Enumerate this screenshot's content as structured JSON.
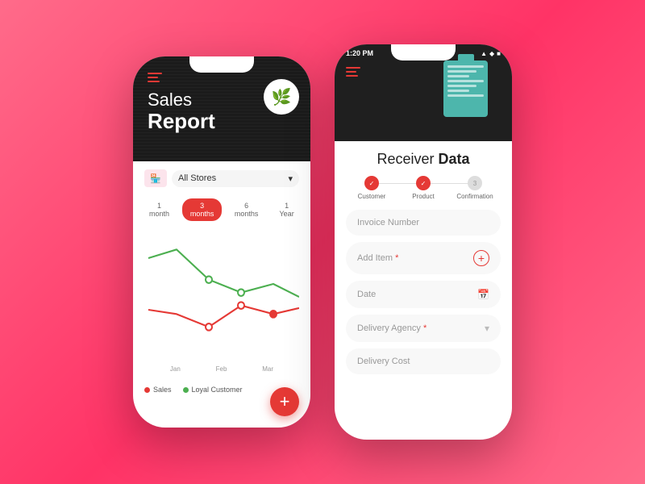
{
  "left_phone": {
    "header": {
      "title": "Sales",
      "title_bold": "Report",
      "store_label": "All Stores"
    },
    "periods": [
      {
        "label": "1 month",
        "active": false
      },
      {
        "label": "3 months",
        "active": true
      },
      {
        "label": "6 months",
        "active": false
      },
      {
        "label": "1 Year",
        "active": false
      }
    ],
    "x_labels": [
      "Jan",
      "Feb",
      "Mar"
    ],
    "legend": [
      {
        "label": "Sales",
        "color": "#e53935"
      },
      {
        "label": "Loyal Customer",
        "color": "#4caf50"
      }
    ],
    "fab_label": "+"
  },
  "right_phone": {
    "status_bar": {
      "time": "1:20 PM",
      "icons": "▲ ◆ ■"
    },
    "title": "Receiver",
    "title_bold": "Data",
    "steps": [
      {
        "label": "Customer",
        "active": true
      },
      {
        "label": "Product",
        "active": true
      },
      {
        "label": "Confirmation",
        "active": false
      }
    ],
    "fields": [
      {
        "label": "Invoice Number",
        "icon": "none",
        "type": "text"
      },
      {
        "label": "Add Item",
        "required": true,
        "icon": "plus",
        "type": "add"
      },
      {
        "label": "Date",
        "icon": "calendar",
        "type": "date"
      },
      {
        "label": "Delivery Agency",
        "required": true,
        "icon": "chevron",
        "type": "select"
      },
      {
        "label": "Delivery Cost",
        "icon": "none",
        "type": "text"
      }
    ]
  },
  "icons": {
    "hamburger": "☰",
    "chevron_down": "⌄",
    "calendar": "📅",
    "plus": "+",
    "check": "✓"
  }
}
